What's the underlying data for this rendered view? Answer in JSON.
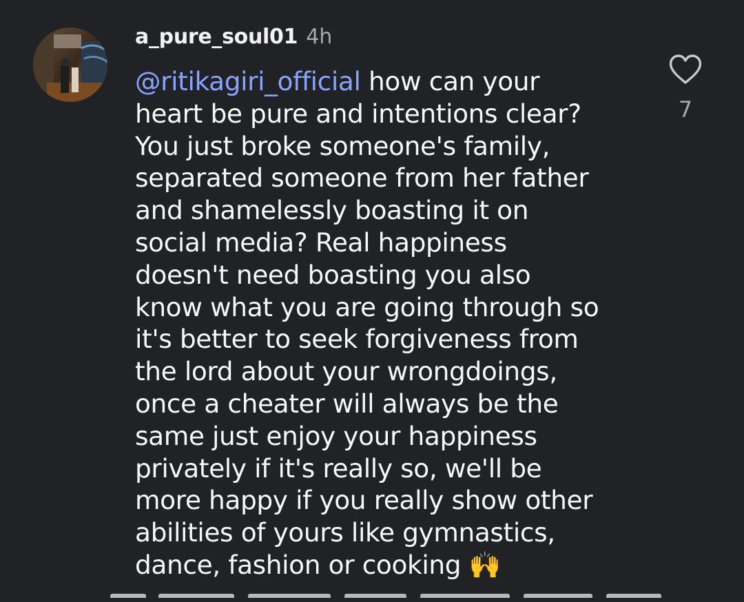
{
  "comment": {
    "username": "a_pure_soul01",
    "timestamp": "4h",
    "mention": "@ritikagiri_official",
    "lines": [
      " how can your",
      "heart be pure and intentions clear?",
      "You just broke someone's family,",
      "separated someone from her father",
      "and shamelessly boasting it on",
      "social media? Real happiness",
      "doesn't need boasting you also",
      "know what you are going through so",
      "it's better to seek forgiveness from",
      "the lord about your wrongdoings,",
      "once a cheater will always be the",
      "same just enjoy your happiness",
      "privately if it's really so, we'll be",
      "more happy if you really show other",
      "abilities of yours like gymnastics,",
      "dance, fashion or cooking"
    ],
    "emoji": "🙌",
    "likes": "7",
    "colors": {
      "background": "#212226",
      "mention": "#8aa3ff",
      "text": "#f7f7f7",
      "muted": "#a8a8a8"
    },
    "icons": {
      "like": "heart-outline-icon",
      "emoji": "raising-hands-emoji"
    }
  }
}
